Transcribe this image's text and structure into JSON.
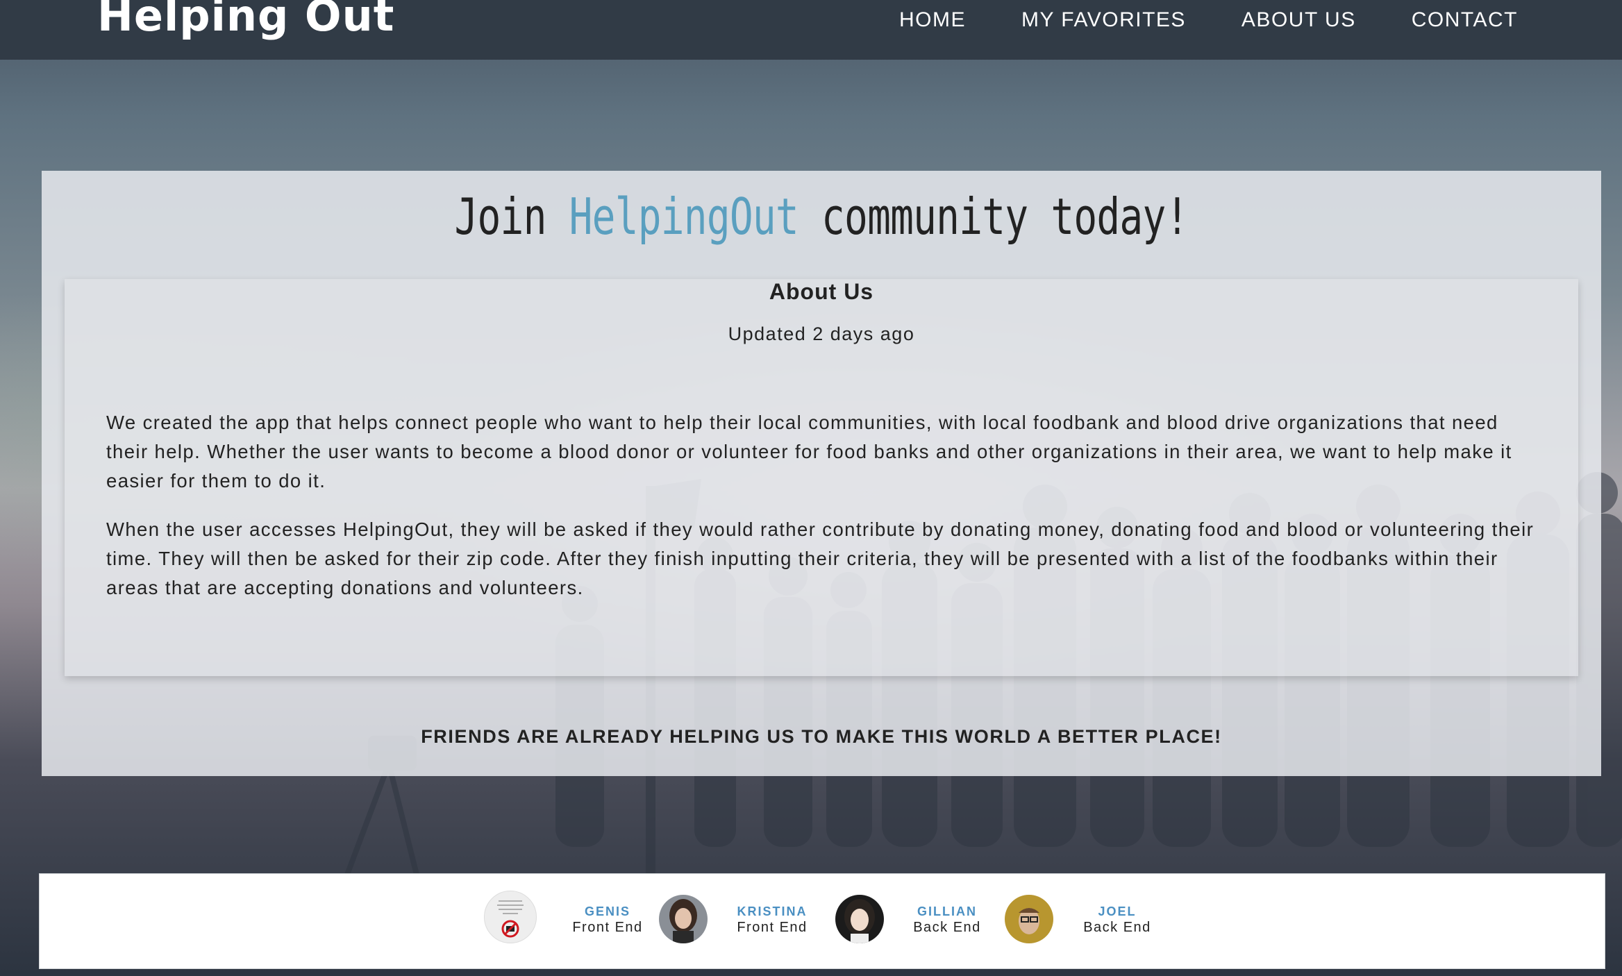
{
  "header": {
    "logo": "Helping Out",
    "nav": [
      "HOME",
      "MY FAVORITES",
      "ABOUT US",
      "CONTACT"
    ]
  },
  "main": {
    "headline_pre": "Join ",
    "headline_brand": "HelpingOut",
    "headline_post": " community today!",
    "about": {
      "title": "About Us",
      "updated": "Updated 2 days ago",
      "paragraphs": [
        "We created the app that helps connect people who want to help their local communities, with local foodbank and blood drive organizations that need their help. Whether the user wants to become a blood donor or volunteer for food banks and other organizations in their area, we want to help make it easier for them to do it.",
        "When the user accesses HelpingOut, they will be asked if they would rather contribute by donating money, donating food and blood or volunteering their time. They will then be asked for their zip code. After they finish inputting their criteria, they will be presented with a list of the foodbanks within their areas that are accepting donations and volunteers."
      ]
    },
    "friends_tagline": "FRIENDS ARE ALREADY HELPING US TO MAKE THIS WORLD A BETTER PLACE!"
  },
  "team": [
    {
      "name": "GENIS",
      "role": "Front End"
    },
    {
      "name": "KRISTINA",
      "role": "Front End"
    },
    {
      "name": "GILLIAN",
      "role": "Back End"
    },
    {
      "name": "JOEL",
      "role": "Back End"
    }
  ],
  "colors": {
    "topbar": "#313b46",
    "brand_accent": "#5a9fbf",
    "member_name": "#4a8fc2",
    "text": "#222222"
  }
}
